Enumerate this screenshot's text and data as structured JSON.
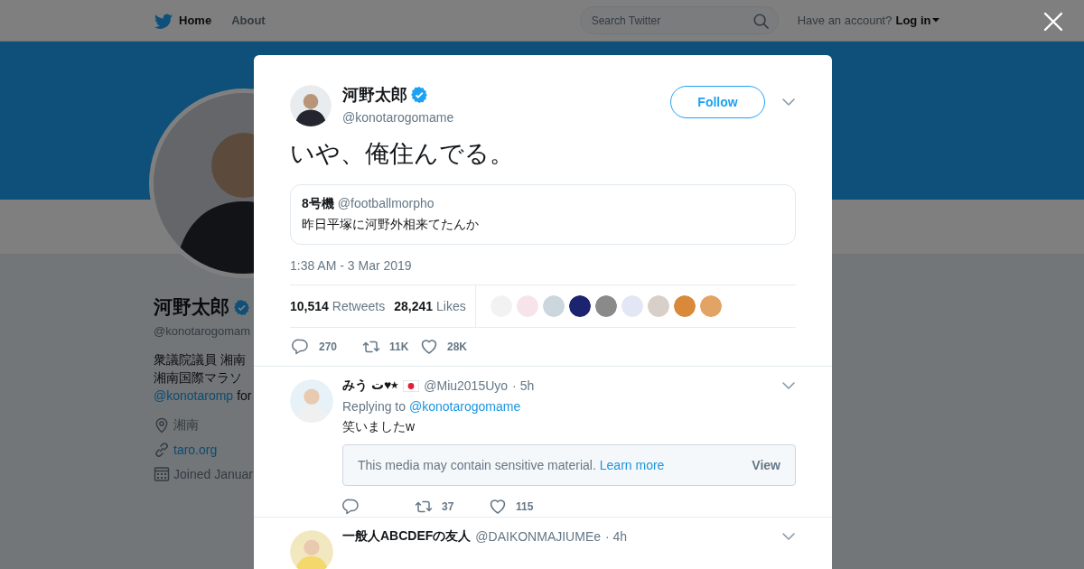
{
  "nav": {
    "items": [
      {
        "label": "Home",
        "selected": true
      },
      {
        "label": "About",
        "selected": false
      }
    ],
    "search": {
      "placeholder": "Search Twitter"
    },
    "account_prompt": "Have an account?",
    "login": "Log in"
  },
  "profile": {
    "name": "河野太郎",
    "verified": true,
    "handle": "@konotarogomam",
    "bio_lines": [
      "衆議院議員 湘南",
      "湘南国際マラソ"
    ],
    "bio_link": "@konotaromp",
    "bio_link_suffix": "for",
    "location": "湘南",
    "website": "taro.org",
    "joined": "Joined Januar"
  },
  "tweet": {
    "author": "河野太郎",
    "verified": true,
    "handle": "@konotarogomame",
    "follow": "Follow",
    "text": "いや、俺住んでる。",
    "quoted": {
      "author": "8号機",
      "handle": "@footballmorpho",
      "text": "昨日平塚に河野外相来てたんか"
    },
    "time": "1:38 AM - 3 Mar 2019",
    "retweets": "10,514",
    "retweets_label": "Retweets",
    "likes": "28,241",
    "likes_label": "Likes",
    "likers": [
      {
        "color": "#f2f2f2"
      },
      {
        "color": "#f7e4ea"
      },
      {
        "color": "#ccd6dd"
      },
      {
        "color": "#1c2470"
      },
      {
        "color": "#8a8a8a"
      },
      {
        "color": "#e3e6f4"
      },
      {
        "color": "#d8cfc8"
      },
      {
        "color": "#d9893a"
      },
      {
        "color": "#e2a464"
      }
    ],
    "actions": [
      {
        "kind": "reply",
        "count": "270"
      },
      {
        "kind": "retweet",
        "count": "11K"
      },
      {
        "kind": "like",
        "count": "28K"
      }
    ]
  },
  "replies": [
    {
      "name": "みう ت♥⭑",
      "flag_badge": true,
      "handle": "@Miu2015Uyo",
      "time": "· 5h",
      "replying_label": "Replying to",
      "replying_to": "@konotarogomame",
      "text": "笑いましたw",
      "sensitive": {
        "text": "This media may contain sensitive material.",
        "link": "Learn more",
        "button": "View"
      },
      "actions": [
        {
          "kind": "reply"
        },
        {
          "kind": "retweet",
          "count": "37"
        },
        {
          "kind": "like",
          "count": "115"
        }
      ]
    },
    {
      "name": "一般人ABCDEFの友人",
      "flag_badge": false,
      "handle": "@DAIKONMAJIUMEe",
      "time": "· 4h"
    }
  ]
}
